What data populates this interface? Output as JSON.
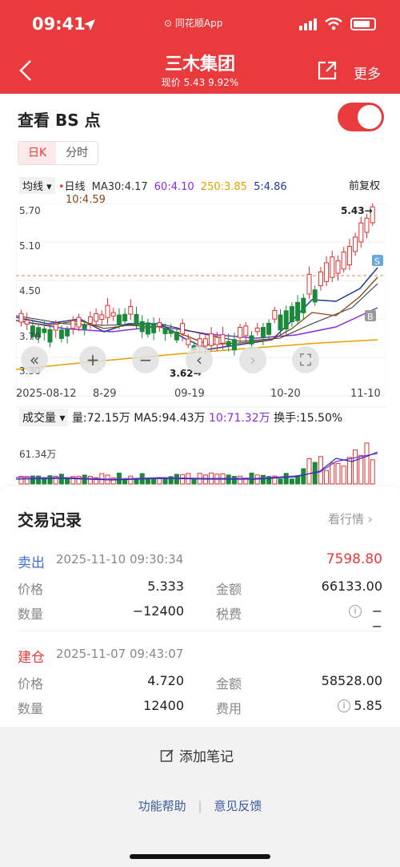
{
  "status": {
    "time": "09:41",
    "app": "同花顺App"
  },
  "header": {
    "title": "三木集团",
    "subtitle": "现价 5.43 9.92%",
    "more": "更多"
  },
  "bs": {
    "label": "查看 BS 点",
    "toggle_on": true
  },
  "kline_tabs": [
    "日K",
    "分时"
  ],
  "ma_row": {
    "selector": "均线",
    "line": "日线",
    "ma30": "MA30:4.17",
    "ma60": "60:4.10",
    "ma250": "250:3.85",
    "ma5": "5:4.86",
    "ma10": "10:4.59",
    "adjust": "前复权"
  },
  "price_labels": [
    "5.70",
    "5.10",
    "4.50",
    "3.70",
    "3.30"
  ],
  "high_label": "5.43→",
  "low_label": "3.62→",
  "date_labels": [
    "2025-08-12",
    "8-29",
    "09-19",
    "10-20",
    "11-10"
  ],
  "volume_row": {
    "selector": "成交量",
    "vol": "量:72.15万",
    "ma5": "MA5:94.43万",
    "ma10": "10:71.32万",
    "turnover": "换手:15.50%",
    "axis_label": "61.34万"
  },
  "colors": {
    "brand_red": "#e93a3d",
    "up": "#e03030",
    "down": "#1a8a3a",
    "ma5": "#1f3c9e",
    "ma10": "#8b4513",
    "ma30": "#333333",
    "ma60": "#8a2be2",
    "ma250": "#e8a000"
  },
  "chart_data": {
    "type": "candlestick",
    "x_labels": [
      "2025-08-12",
      "8-29",
      "09-19",
      "10-20",
      "11-10"
    ],
    "ylim": [
      3.3,
      5.7
    ],
    "markers": [
      {
        "type": "S",
        "price": 5.12
      },
      {
        "type": "B",
        "price": 4.05
      }
    ],
    "latest_price": 5.43,
    "low_price": 3.62
  },
  "records": {
    "title": "交易记录",
    "link": "看行情",
    "items": [
      {
        "type": "卖出",
        "datetime": "2025-11-10 09:30:34",
        "total": "7598.80",
        "price_label": "价格",
        "price": "5.333",
        "amount_label": "金额",
        "amount": "66133.00",
        "qty_label": "数量",
        "qty": "−12400",
        "fee_label": "税费",
        "fee": "−−"
      },
      {
        "type": "建仓",
        "datetime": "2025-11-07 09:43:07",
        "total": "",
        "price_label": "价格",
        "price": "4.720",
        "amount_label": "金额",
        "amount": "58528.00",
        "qty_label": "数量",
        "qty": "12400",
        "fee_label": "费用",
        "fee": "5.85"
      }
    ]
  },
  "footer": {
    "add_note": "添加笔记",
    "help": "功能帮助",
    "feedback": "意见反馈"
  }
}
